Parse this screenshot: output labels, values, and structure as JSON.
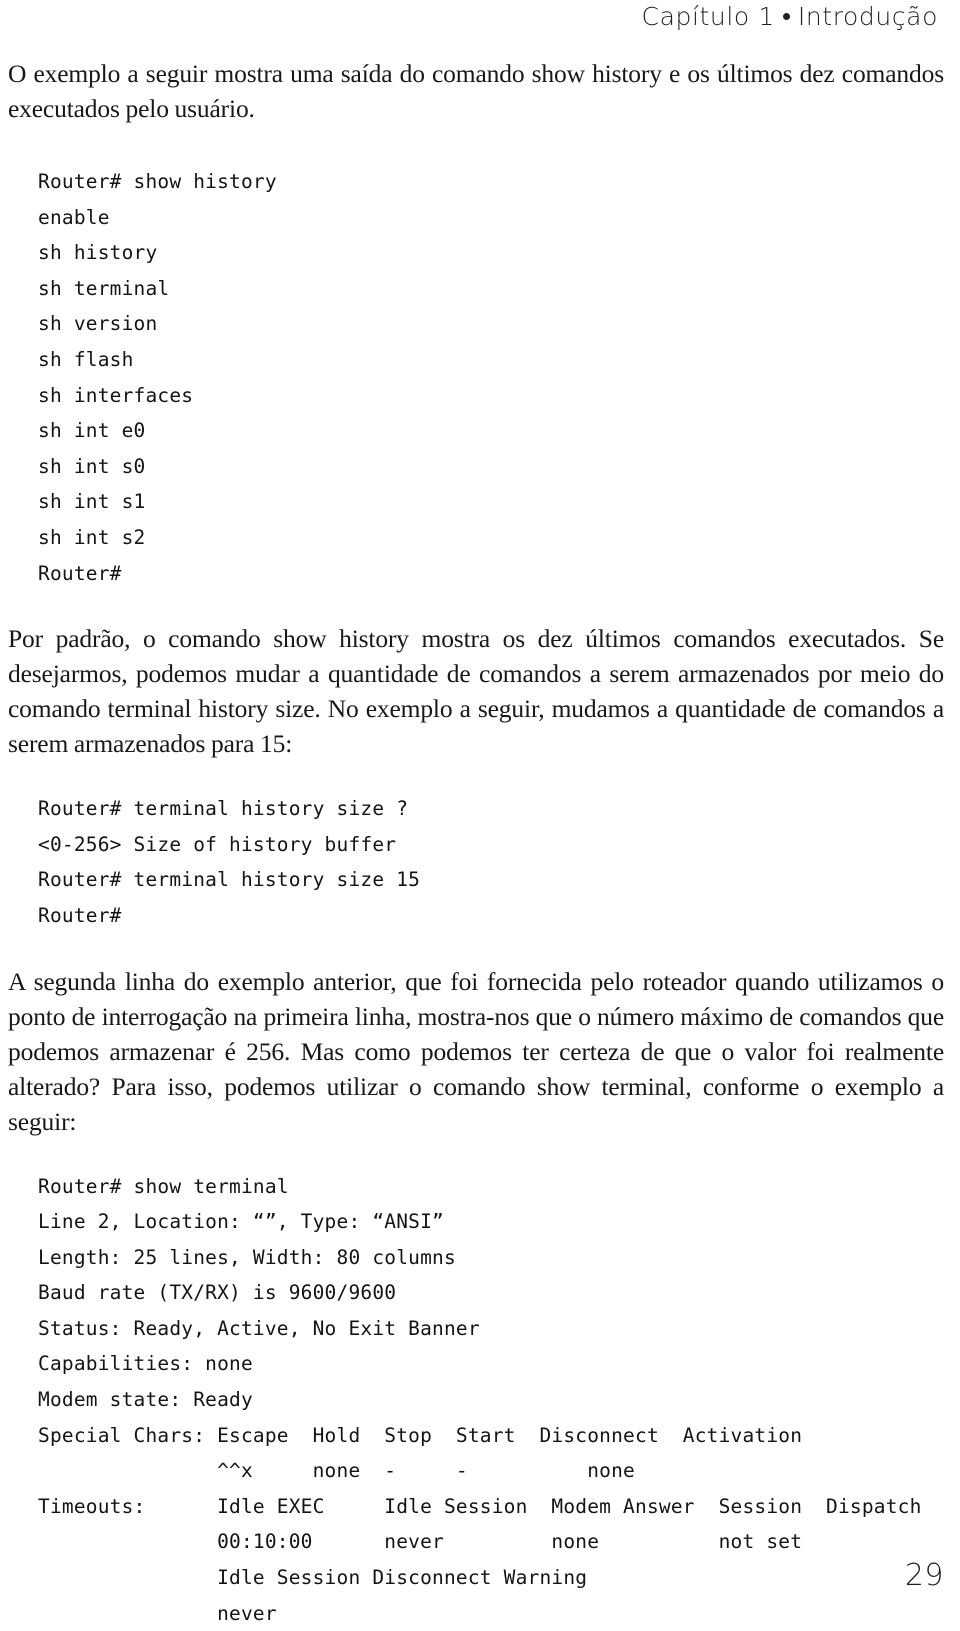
{
  "header": {
    "chapter_label": "Capítulo 1",
    "separator_icon": "bullet-dot",
    "chapter_title": "Introdução",
    "full_text": "Capítulo 1 • Introdução"
  },
  "paragraphs": {
    "intro": "O exemplo a seguir mostra uma saída do comando show history e os últimos dez comandos executados pelo usuário.",
    "default_history": "Por padrão, o comando show history mostra os dez últimos comandos executados. Se desejarmos, podemos mudar a quantidade de comandos a serem armazenados por meio do comando terminal history size. No exemplo a seguir, mudamos a quantidade de comandos a serem armazenados para 15:",
    "second_line_explanation": "A segunda linha do exemplo anterior, que foi fornecida pelo roteador quando utilizamos o ponto de interrogação na primeira linha, mostra-nos que o número máximo de comandos que podemos armazenar é 256. Mas como podemos ter certeza de que o valor foi realmente alterado? Para isso, podemos utilizar o comando show terminal, conforme o exemplo a seguir:"
  },
  "console_blocks": {
    "show_history": {
      "prompt": "Router#",
      "command": "show history",
      "lines": [
        "Router# show history",
        "enable",
        "sh history",
        "sh terminal",
        "sh version",
        "sh flash",
        "sh interfaces",
        "sh int e0",
        "sh int s0",
        "sh int s1",
        "sh int s2",
        "Router#"
      ],
      "text": "Router# show history\nenable\nsh history\nsh terminal\nsh version\nsh flash\nsh interfaces\nsh int e0\nsh int s0\nsh int s1\nsh int s2\nRouter#"
    },
    "terminal_history_size": {
      "prompt": "Router#",
      "command": "terminal history size",
      "help_range": "<0-256>",
      "help_text": "Size of history buffer",
      "new_size": "15",
      "lines": [
        "Router# terminal history size ?",
        "<0-256> Size of history buffer",
        "Router# terminal history size 15",
        "Router#"
      ],
      "text": "Router# terminal history size ?\n<0-256> Size of history buffer\nRouter# terminal history size 15\nRouter#"
    },
    "show_terminal": {
      "prompt": "Router#",
      "command": "show terminal",
      "fields": {
        "line": "Line 2",
        "location": "“”",
        "type": "“ANSI”",
        "length": "25 lines",
        "width": "80 columns",
        "baud_rate": "9600/9600",
        "status": "Ready, Active, No Exit Banner",
        "capabilities": "none",
        "modem_state": "Ready"
      },
      "special_chars": {
        "label": "Special Chars:",
        "headers": [
          "Escape",
          "Hold",
          "Stop",
          "Start",
          "Disconnect",
          "Activation"
        ],
        "values": [
          "^^x",
          "none",
          "-",
          "-",
          "none"
        ]
      },
      "timeouts": {
        "label": "Timeouts:",
        "headers": [
          "Idle EXEC",
          "Idle Session",
          "Modem Answer",
          "Session",
          "Dispatch"
        ],
        "values": [
          "00:10:00",
          "never",
          "none",
          "not set"
        ],
        "warning_label": "Idle Session Disconnect Warning",
        "warning_value": "never"
      },
      "lines": [
        "Router# show terminal",
        "Line 2, Location: “”, Type: “ANSI”",
        "Length: 25 lines, Width: 80 columns",
        "Baud rate (TX/RX) is 9600/9600",
        "Status: Ready, Active, No Exit Banner",
        "Capabilities: none",
        "Modem state: Ready",
        "Special Chars: Escape  Hold  Stop  Start  Disconnect  Activation",
        "               ^^x     none  -     -          none",
        "Timeouts:      Idle EXEC     Idle Session  Modem Answer  Session  Dispatch",
        "               00:10:00      never         none          not set",
        "               Idle Session Disconnect Warning",
        "               never"
      ],
      "text": "Router# show terminal\nLine 2, Location: “”, Type: “ANSI”\nLength: 25 lines, Width: 80 columns\nBaud rate (TX/RX) is 9600/9600\nStatus: Ready, Active, No Exit Banner\nCapabilities: none\nModem state: Ready\nSpecial Chars: Escape  Hold  Stop  Start  Disconnect  Activation\n               ^^x     none  -     -          none\nTimeouts:      Idle EXEC     Idle Session  Modem Answer  Session  Dispatch\n               00:10:00      never         none          not set\n               Idle Session Disconnect Warning\n               never"
    }
  },
  "folio": {
    "page_number": "29"
  }
}
